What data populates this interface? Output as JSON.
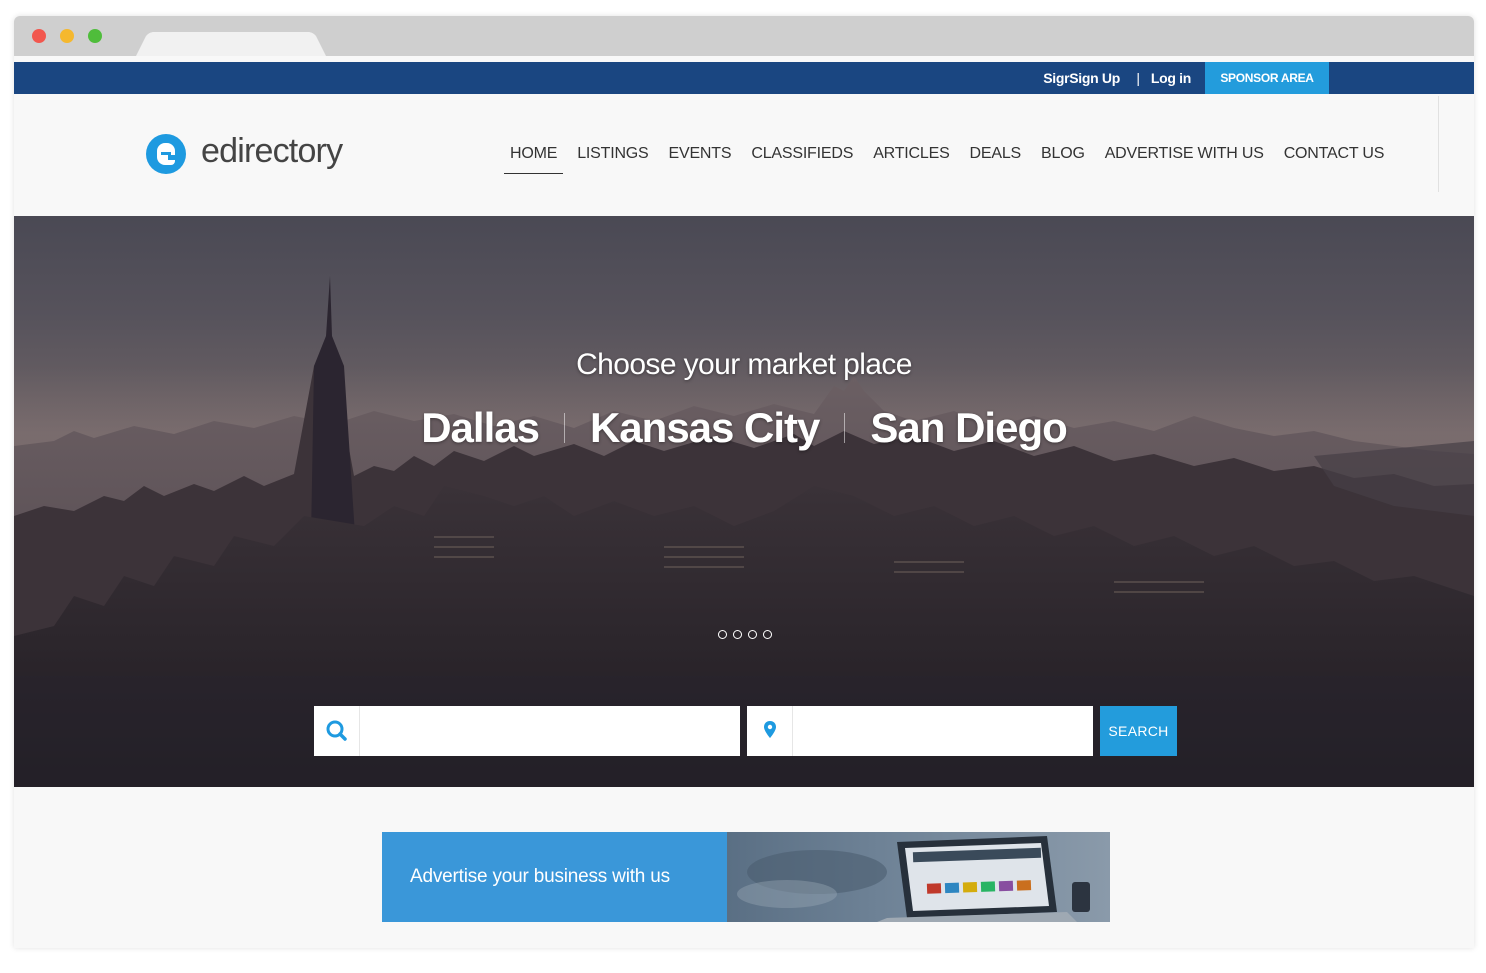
{
  "topbar": {
    "signup_label": "SigrSign Up",
    "separator": "|",
    "login_label": "Log in",
    "sponsor_label": "SPONSOR AREA"
  },
  "header": {
    "logo_text": "edirectory",
    "nav": [
      "HOME",
      "LISTINGS",
      "EVENTS",
      "CLASSIFIEDS",
      "ARTICLES",
      "DEALS",
      "BLOG",
      "ADVERTISE WITH US",
      "CONTACT US"
    ],
    "active_nav": "HOME"
  },
  "hero": {
    "title": "Choose your market place",
    "markets": [
      "Dallas",
      "Kansas City",
      "San Diego"
    ],
    "slide_count": 4
  },
  "search": {
    "what_placeholder": "",
    "where_placeholder": "",
    "button_label": "SEARCH"
  },
  "ad": {
    "text": "Advertise your business with us"
  },
  "colors": {
    "topbar": "#1a4681",
    "accent": "#239cdc",
    "ad_blue": "#3a97d9"
  },
  "icons": {
    "search": "search-icon",
    "location": "map-pin-icon",
    "logo": "edirectory-logo-icon"
  }
}
